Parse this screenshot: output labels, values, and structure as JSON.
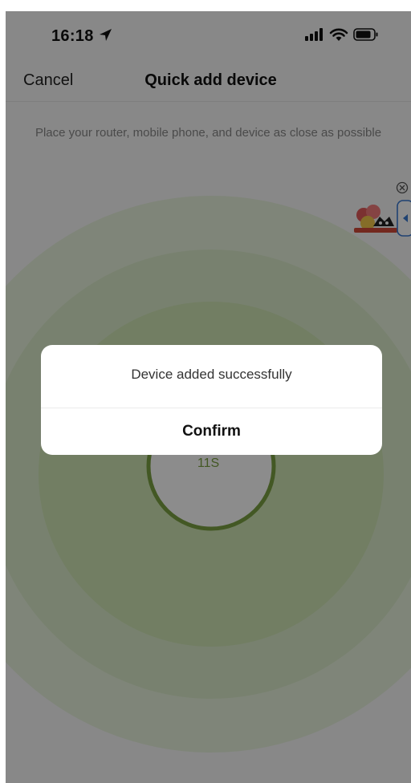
{
  "status_bar": {
    "time": "16:18",
    "icons": [
      "location-arrow-icon",
      "signal-icon",
      "wifi-icon",
      "battery-icon"
    ]
  },
  "nav": {
    "cancel_label": "Cancel",
    "title": "Quick add device"
  },
  "hint_text": "Place your router, mobile phone, and device as close as possible",
  "scan": {
    "countdown": "11S",
    "ring_color": "#cfe6b4",
    "accent_color": "#7ba043"
  },
  "dialog": {
    "message": "Device added successfully",
    "confirm_label": "Confirm"
  },
  "floating_widget": {
    "icons": [
      "close-circle-icon",
      "sticker-icon",
      "expand-arrow-icon"
    ]
  }
}
